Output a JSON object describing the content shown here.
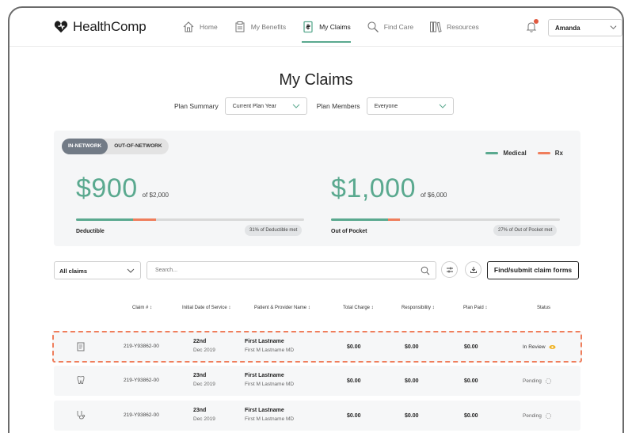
{
  "brand": {
    "name": "HealthComp"
  },
  "nav": {
    "items": [
      {
        "label": "Home",
        "icon": "home-icon",
        "active": false
      },
      {
        "label": "My Benefits",
        "icon": "benefits-icon",
        "active": false
      },
      {
        "label": "My Claims",
        "icon": "claims-icon",
        "active": true
      },
      {
        "label": "Find Care",
        "icon": "search-icon",
        "active": false
      },
      {
        "label": "Resources",
        "icon": "resources-icon",
        "active": false
      }
    ],
    "user": "Amanda"
  },
  "page": {
    "title": "My Claims"
  },
  "filters": {
    "plan_summary_label": "Plan Summary",
    "plan_summary_value": "Current Plan Year",
    "plan_members_label": "Plan Members",
    "plan_members_value": "Everyone"
  },
  "summary": {
    "toggle": {
      "in_network": "IN-NETWORK",
      "out_network": "OUT-OF-NETWORK"
    },
    "legend": {
      "medical": "Medical",
      "rx": "Rx"
    },
    "colors": {
      "medical": "#5aa98f",
      "rx": "#ef7e5c"
    },
    "deductible": {
      "amount": "$900",
      "of": "of $2,000",
      "label": "Deductible",
      "pill": "31% of Deductible met",
      "medical_fraction": 0.25,
      "rx_fraction": 0.1
    },
    "oop": {
      "amount": "$1,000",
      "of": "of $6,000",
      "label": "Out of Pocket",
      "pill": "27% of Out of Pocket met",
      "medical_fraction": 0.25,
      "rx_fraction": 0.05
    }
  },
  "toolbar": {
    "claims_filter": "All claims",
    "search_placeholder": "Search...",
    "find_submit": "Find/submit claim forms"
  },
  "table": {
    "headers": {
      "claim": "Claim # ↕",
      "date": "Initial Date of Service ↕",
      "patient": "Patient & Provider Name ↕",
      "total": "Total Charge ↕",
      "resp": "Responsibility ↕",
      "paid": "Plan Paid ↕",
      "status": "Status"
    },
    "rows": [
      {
        "icon": "document-icon",
        "claim": "219-Y93862-00",
        "day": "22nd",
        "month": "Dec 2019",
        "patient": "First Lastname",
        "provider": "First M Lastname MD",
        "total": "$0.00",
        "resp": "$0.00",
        "paid": "$0.00",
        "status": "In Review"
      },
      {
        "icon": "tooth-icon",
        "claim": "219-Y93862-00",
        "day": "23nd",
        "month": "Dec 2019",
        "patient": "First Lastname",
        "provider": "First M Lastname MD",
        "total": "$0.00",
        "resp": "$0.00",
        "paid": "$0.00",
        "status": "Pending"
      },
      {
        "icon": "stethoscope-icon",
        "claim": "219-Y93862-00",
        "day": "23nd",
        "month": "Dec 2019",
        "patient": "First Lastname",
        "provider": "First M Lastname MD",
        "total": "$0.00",
        "resp": "$0.00",
        "paid": "$0.00",
        "status": "Pending"
      }
    ]
  }
}
